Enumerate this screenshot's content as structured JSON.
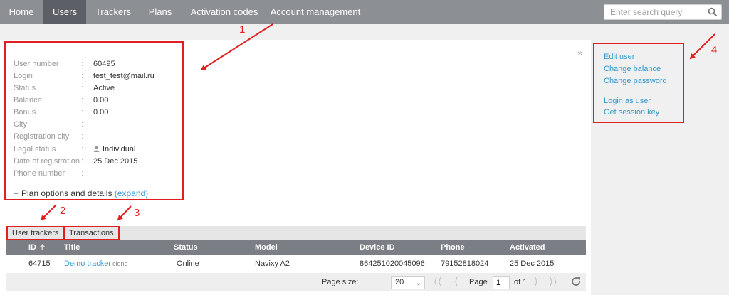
{
  "nav": {
    "items": [
      "Home",
      "Users",
      "Trackers",
      "Plans",
      "Activation codes",
      "Account management"
    ],
    "active": "Users"
  },
  "search": {
    "placeholder": "Enter search query"
  },
  "collapse_glyph": "»",
  "user_info": [
    {
      "label": "User number",
      "value": "60495"
    },
    {
      "label": "Login",
      "value": "test_test@mail.ru"
    },
    {
      "label": "Status",
      "value": "Active"
    },
    {
      "label": "Balance",
      "value": "0.00"
    },
    {
      "label": "Bonus",
      "value": "0.00"
    },
    {
      "label": "City",
      "value": ""
    },
    {
      "label": "Registration city",
      "value": ""
    },
    {
      "label": "Legal status",
      "value": "Individual"
    },
    {
      "label": "Date of registration",
      "value": "25 Dec 2015"
    },
    {
      "label": "Phone number",
      "value": ""
    }
  ],
  "plan": {
    "plus": "+",
    "text": "Plan options and details",
    "link": "(expand)"
  },
  "actions": [
    "Edit user",
    "Change balance",
    "Change password",
    "Login as user",
    "Get session key"
  ],
  "annotations": [
    "1",
    "2",
    "3",
    "4"
  ],
  "tabs": [
    "User trackers",
    "Transactions"
  ],
  "table": {
    "headers": [
      "ID",
      "Title",
      "Status",
      "Model",
      "Device ID",
      "Phone",
      "Activated"
    ],
    "row": {
      "id": "64715",
      "title": "Demo tracker",
      "title_suffix": "clone",
      "status": "Online",
      "model": "Navixy A2",
      "device_id": "864251020045096",
      "phone": "79152818024",
      "activated": "25 Dec 2015"
    }
  },
  "pager": {
    "page_size_label": "Page size:",
    "page_size": "20",
    "page_label": "Page",
    "page": "1",
    "of_label": "of 1"
  },
  "colors": {
    "nav_bg": "#8c8f94",
    "nav_active": "#5c5f66",
    "annotation": "#e02020",
    "link": "#3399cc",
    "table_head": "#7b7e84"
  }
}
